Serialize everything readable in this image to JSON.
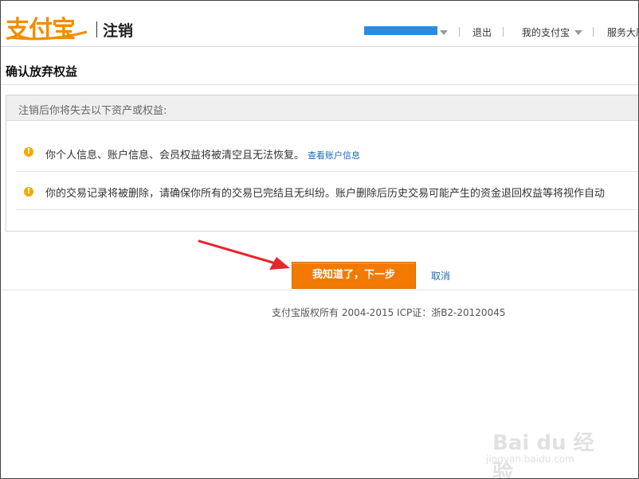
{
  "header": {
    "logo_text": "支付宝",
    "page_label": "注销",
    "nav": {
      "logout": "退出",
      "my_alipay": "我的支付宝",
      "service_hall": "服务大厅"
    }
  },
  "main": {
    "title": "确认放弃权益",
    "notice_heading": "注销后你将失去以下资产或权益:",
    "items": [
      {
        "text": "你个人信息、账户信息、会员权益将被清空且无法恢复。",
        "link": "查看账户信息"
      },
      {
        "text": "你的交易记录将被删除，请确保你所有的交易已完结且无纠纷。账户删除后历史交易可能产生的资金退回权益等将视作自动",
        "link": ""
      }
    ],
    "primary_button": "我知道了，下一步",
    "cancel_link": "取消"
  },
  "footer": {
    "copyright": "支付宝版权所有 2004-2015 ICP证：浙B2-20120045"
  },
  "watermark": {
    "brand": "Bai du 经验",
    "site": "jingyan.baidu.com"
  },
  "colors": {
    "brand_orange": "#f28c00",
    "button_orange": "#f27a00",
    "link_blue": "#1a6ab8",
    "warning": "#f2a900",
    "annotation_red": "#e8252b"
  }
}
